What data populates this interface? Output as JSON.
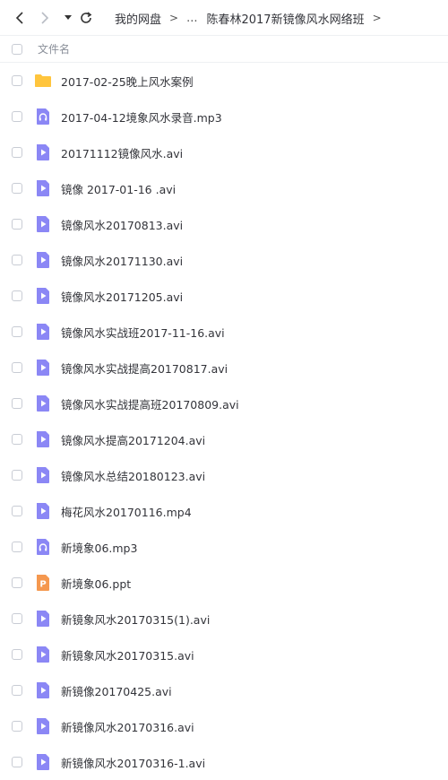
{
  "breadcrumb": {
    "root": "我的网盘",
    "ellipsis": "...",
    "current": "陈春林2017新镜像风水网络班"
  },
  "header": {
    "column_name": "文件名"
  },
  "files": [
    {
      "name": "2017-02-25晚上风水案例",
      "type": "folder"
    },
    {
      "name": "2017-04-12境象风水录音.mp3",
      "type": "audio"
    },
    {
      "name": "20171112镜像风水.avi",
      "type": "video"
    },
    {
      "name": "镜像 2017-01-16 .avi",
      "type": "video"
    },
    {
      "name": "镜像风水20170813.avi",
      "type": "video"
    },
    {
      "name": "镜像风水20171130.avi",
      "type": "video"
    },
    {
      "name": "镜像风水20171205.avi",
      "type": "video"
    },
    {
      "name": "镜像风水实战班2017-11-16.avi",
      "type": "video"
    },
    {
      "name": "镜像风水实战提高20170817.avi",
      "type": "video"
    },
    {
      "name": "镜像风水实战提高班20170809.avi",
      "type": "video"
    },
    {
      "name": "镜像风水提高20171204.avi",
      "type": "video"
    },
    {
      "name": "镜像风水总结20180123.avi",
      "type": "video"
    },
    {
      "name": "梅花风水20170116.mp4",
      "type": "video"
    },
    {
      "name": "新境象06.mp3",
      "type": "audio"
    },
    {
      "name": "新境象06.ppt",
      "type": "ppt"
    },
    {
      "name": "新镜象风水20170315(1).avi",
      "type": "video"
    },
    {
      "name": "新镜象风水20170315.avi",
      "type": "video"
    },
    {
      "name": "新镜像20170425.avi",
      "type": "video"
    },
    {
      "name": "新镜像风水20170316.avi",
      "type": "video"
    },
    {
      "name": "新镜像风水20170316-1.avi",
      "type": "video"
    }
  ],
  "colors": {
    "folder": "#ffc53d",
    "media": "#8b87f5",
    "ppt": "#f5984f"
  },
  "icons": {
    "folder": "folder-icon",
    "audio": "audio-file-icon",
    "video": "video-file-icon",
    "ppt": "ppt-file-icon"
  }
}
